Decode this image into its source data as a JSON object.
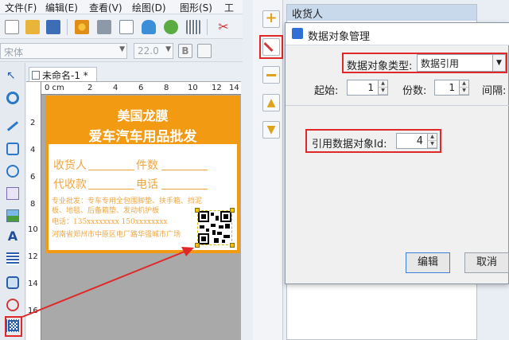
{
  "menu": {
    "file": "文件(F)",
    "edit": "编辑(E)",
    "view": "查看(V)",
    "draw": "绘图(D)",
    "shape": "图形(S)",
    "tools": "工具"
  },
  "fontbar": {
    "font_name": "宋体",
    "font_size": "22.0"
  },
  "tab": {
    "label": "未命名-1 *"
  },
  "ruler": {
    "origin": "0 cm",
    "top_ticks": [
      "2",
      "4",
      "6",
      "8",
      "10",
      "12",
      "14"
    ],
    "left_ticks": [
      "2",
      "4",
      "6",
      "8",
      "10",
      "12",
      "14",
      "16"
    ]
  },
  "label": {
    "title1": "美国龙膜",
    "title2": "爱车汽车用品批发",
    "receiver": "收货人",
    "pieces": "件数",
    "cod": "代收款",
    "phone": "电话",
    "desc1": "专业批发：专车专用全包围脚垫、扶手箱、挡泥",
    "desc2": "板、地毯、后备箱垫、发动机护板",
    "contact": "电话：135xxxxxxxx    150xxxxxxxx",
    "address": "河南省郑州市中原区电厂路华强城市广场"
  },
  "right": {
    "list_header": "收货人"
  },
  "dialog": {
    "title": "数据对象管理",
    "type_label": "数据对象类型:",
    "type_value": "数据引用",
    "start_label": "起始:",
    "start_value": "1",
    "count_label": "份数:",
    "count_value": "1",
    "interval_label": "间隔:",
    "ref_id_label": "引用数据对象Id:",
    "ref_id_value": "4",
    "edit_button": "编辑",
    "cancel_button": "取消"
  },
  "colors": {
    "label_orange": "#f29a12",
    "highlight_red": "#e12828",
    "dialog_blue": "#2f6fd6"
  }
}
